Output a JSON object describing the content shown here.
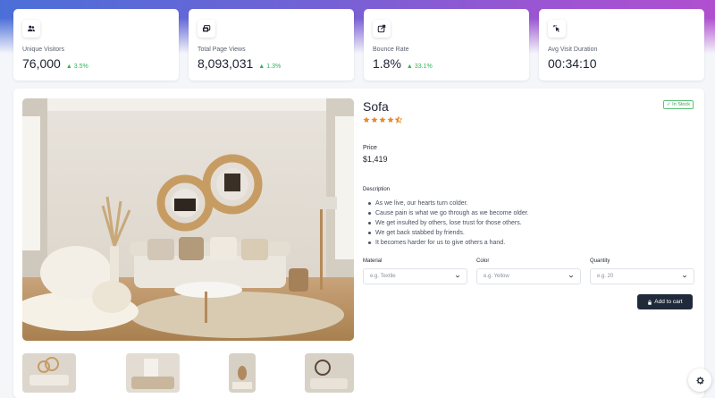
{
  "stats": [
    {
      "label": "Unique Visitors",
      "value": "76,000",
      "change": "3.5%",
      "icon": "users-icon"
    },
    {
      "label": "Total Page Views",
      "value": "8,093,031",
      "change": "1.3%",
      "icon": "page-views-icon"
    },
    {
      "label": "Bounce Rate",
      "value": "1.8%",
      "change": "33.1%",
      "icon": "external-link-icon"
    },
    {
      "label": "Avg Visit Duration",
      "value": "00:34:10",
      "change": "",
      "icon": "pointer-click-icon"
    }
  ],
  "product": {
    "title": "Sofa",
    "stock_status": "In Stock",
    "rating": 4.5,
    "price_label": "Price",
    "price": "$1,419",
    "description_label": "Description",
    "description": [
      "As we live, our hearts turn colder.",
      "Cause pain is what we go through as we become older.",
      "We get insulted by others, lose trust for those others.",
      "We get back stabbed by friends.",
      "It becomes harder for us to give others a hand."
    ],
    "fields": {
      "material": {
        "label": "Material",
        "placeholder": "e.g. Textile"
      },
      "color": {
        "label": "Color",
        "placeholder": "e.g. Yellow"
      },
      "quantity": {
        "label": "Quantity",
        "placeholder": "e.g. 20"
      }
    },
    "cart_button": "Add to cart"
  },
  "colors": {
    "accent": "#1f2a3a",
    "success": "#2fb35a",
    "star": "#e58a2b"
  }
}
